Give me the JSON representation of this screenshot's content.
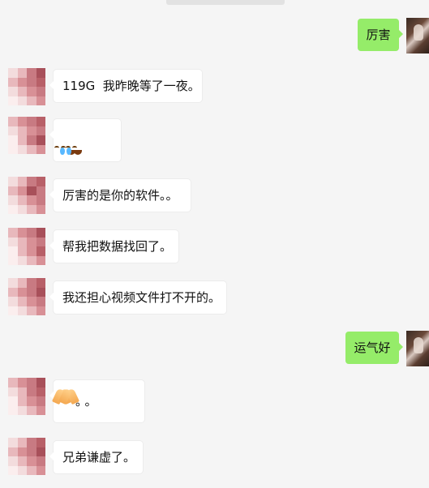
{
  "messages": [
    {
      "id": 1,
      "side": "out",
      "text": "厉害"
    },
    {
      "id": 2,
      "side": "in",
      "text": "119G  我昨晚等了一夜。"
    },
    {
      "id": 3,
      "side": "in",
      "text": "",
      "emoji": [
        "crying-face-emoji",
        "crying-face-emoji"
      ]
    },
    {
      "id": 4,
      "side": "in",
      "text": "厉害的是你的软件。。"
    },
    {
      "id": 5,
      "side": "in",
      "text": "帮我把数据找回了。"
    },
    {
      "id": 6,
      "side": "in",
      "text": "我还担心视频文件打不开的。"
    },
    {
      "id": 7,
      "side": "out",
      "text": "运气好"
    },
    {
      "id": 8,
      "side": "in",
      "text": "。。",
      "emoji": [
        "folded-hands-emoji",
        "folded-hands-emoji"
      ]
    },
    {
      "id": 9,
      "side": "in",
      "text": "兄弟谦虚了。"
    }
  ],
  "colors": {
    "background": "#f5f5f5",
    "incoming_bubble": "#ffffff",
    "outgoing_bubble": "#95ec69",
    "mosaic_light": "#e8b8bc",
    "mosaic_mid": "#c87a82",
    "mosaic_dark": "#a8505a"
  }
}
